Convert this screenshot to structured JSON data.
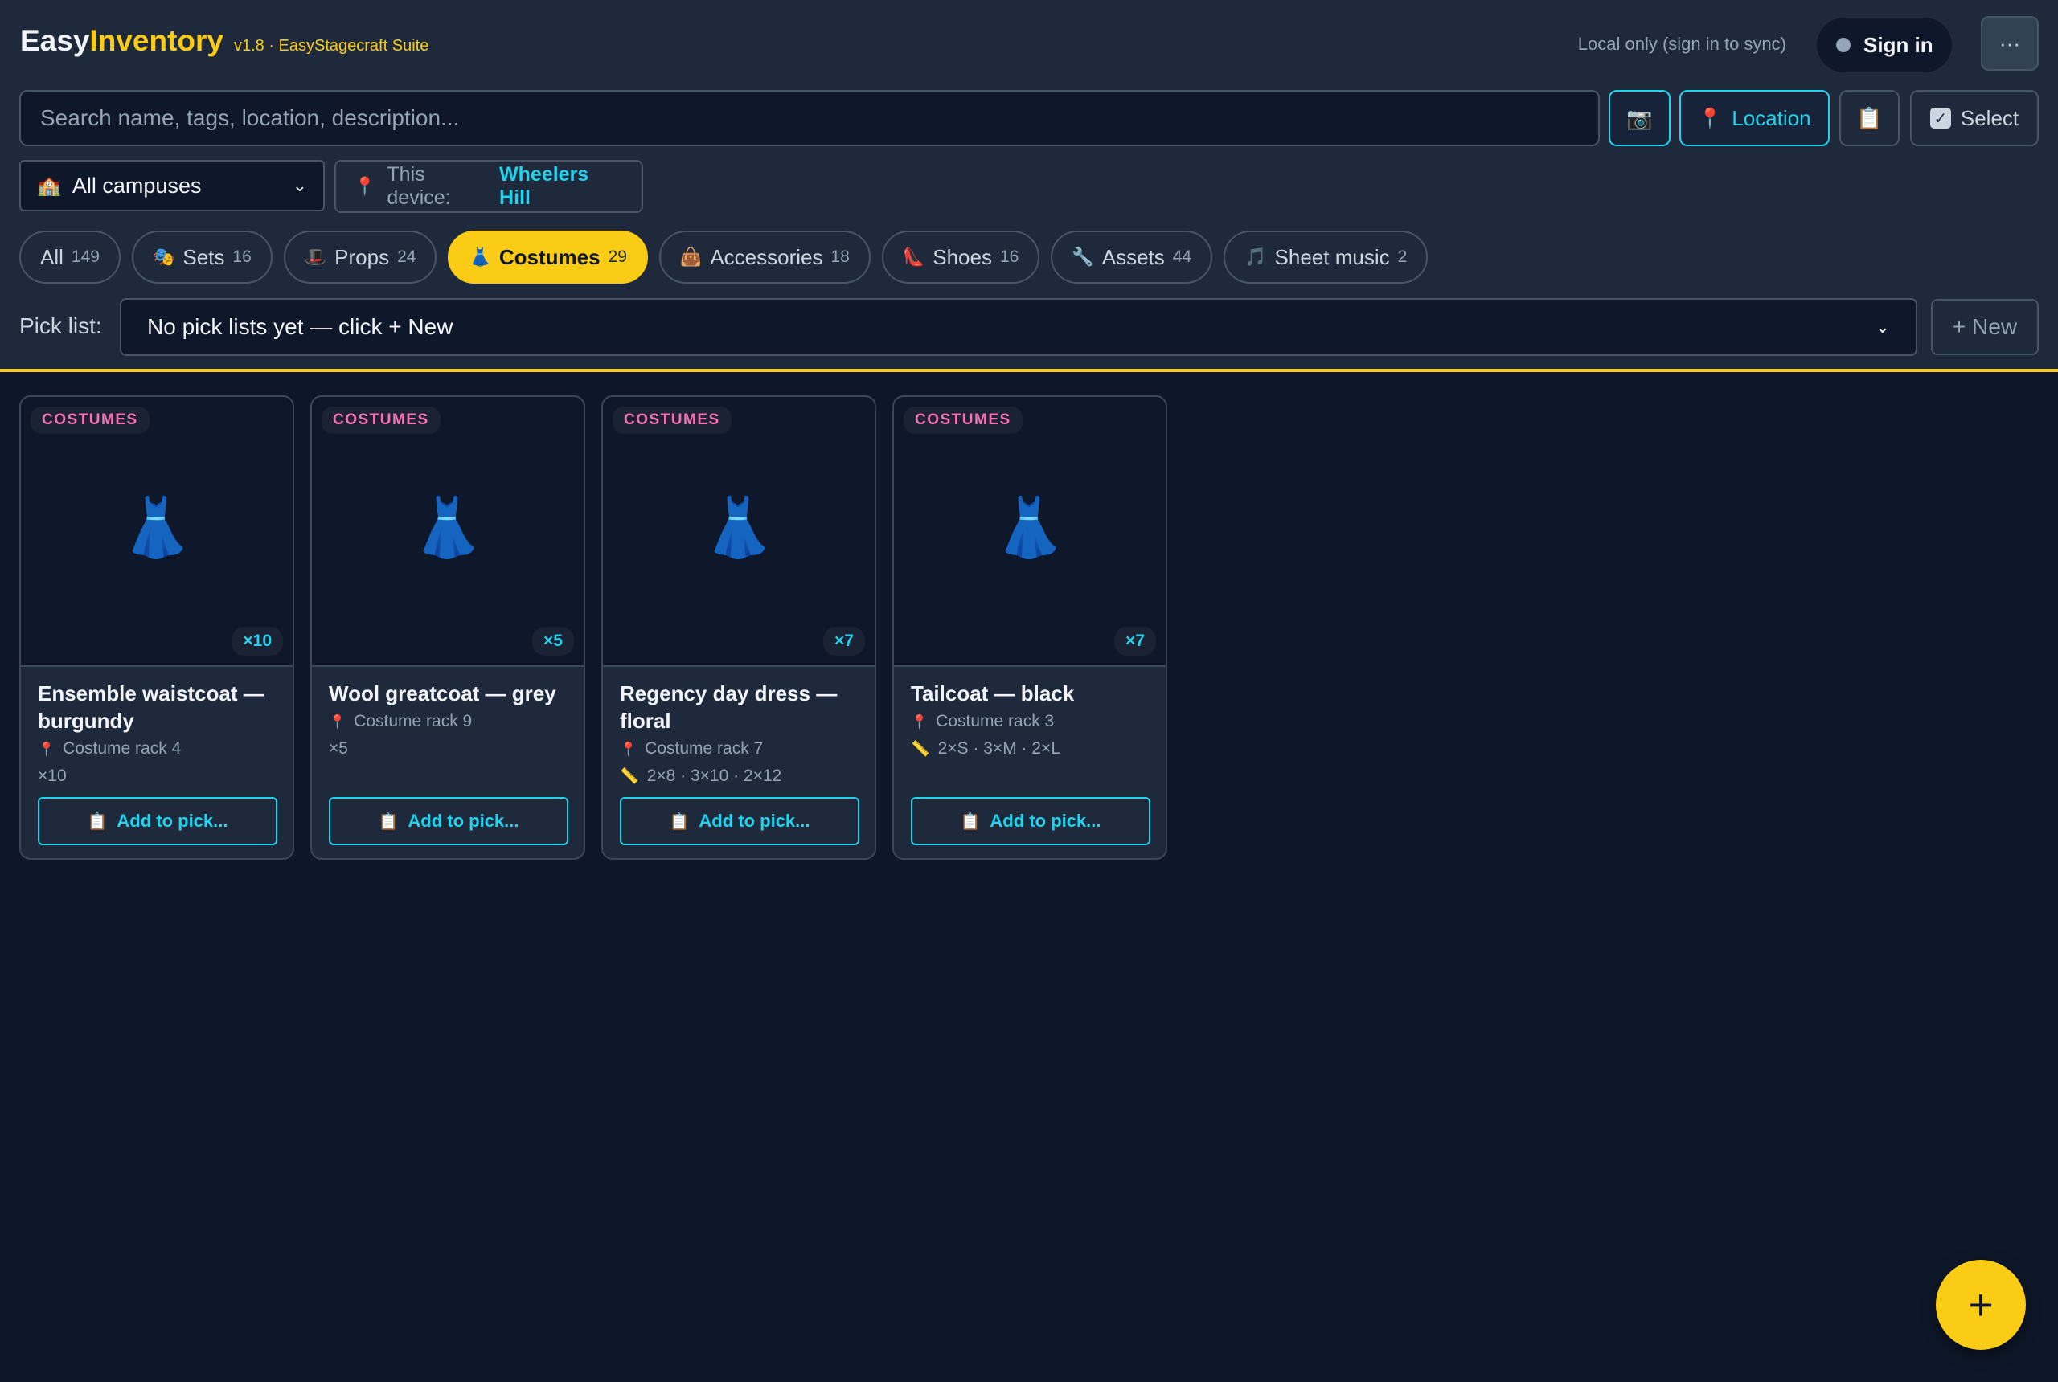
{
  "brand": {
    "easy": "Easy",
    "inventory": "Inventory",
    "version": "v1.8 · EasyStagecraft Suite"
  },
  "sync_status": "Local only (sign in to sync)",
  "signin_label": "Sign in",
  "more_label": "···",
  "search": {
    "placeholder": "Search name, tags, location, description..."
  },
  "toolbar": {
    "camera_icon": "📷",
    "location_label": "Location",
    "location_icon": "📍",
    "clipboard_icon": "📋",
    "select_label": "Select"
  },
  "campus": {
    "selected": "All campuses",
    "icon": "🏫"
  },
  "device": {
    "label": "This device:",
    "value": "Wheelers Hill"
  },
  "categories": [
    {
      "label": "All",
      "count": "149",
      "icon": ""
    },
    {
      "label": "Sets",
      "count": "16",
      "icon": "🎭"
    },
    {
      "label": "Props",
      "count": "24",
      "icon": "🎩"
    },
    {
      "label": "Costumes",
      "count": "29",
      "icon": "👗"
    },
    {
      "label": "Accessories",
      "count": "18",
      "icon": "👜"
    },
    {
      "label": "Shoes",
      "count": "16",
      "icon": "👠"
    },
    {
      "label": "Assets",
      "count": "44",
      "icon": "🔧"
    },
    {
      "label": "Sheet music",
      "count": "2",
      "icon": "🎵"
    }
  ],
  "active_category": "Costumes",
  "pick_list": {
    "label": "Pick list:",
    "selected": "No pick lists yet — click + New",
    "new_label": "+ New"
  },
  "items": [
    {
      "category": "COSTUMES",
      "qty_badge": "×10",
      "title": "Ensemble waistcoat — burgundy",
      "location": "Costume rack 4",
      "meta": "×10",
      "meta_icon": "",
      "add_label": "Add to pick..."
    },
    {
      "category": "COSTUMES",
      "qty_badge": "×5",
      "title": "Wool greatcoat — grey",
      "location": "Costume rack 9",
      "meta": "×5",
      "meta_icon": "",
      "add_label": "Add to pick..."
    },
    {
      "category": "COSTUMES",
      "qty_badge": "×7",
      "title": "Regency day dress — floral",
      "location": "Costume rack 7",
      "meta": "2×8 · 3×10 · 2×12",
      "meta_icon": "📏",
      "add_label": "Add to pick..."
    },
    {
      "category": "COSTUMES",
      "qty_badge": "×7",
      "title": "Tailcoat — black",
      "location": "Costume rack 3",
      "meta": "2×S · 3×M · 2×L",
      "meta_icon": "📏",
      "add_label": "Add to pick..."
    }
  ],
  "fab_label": "+"
}
